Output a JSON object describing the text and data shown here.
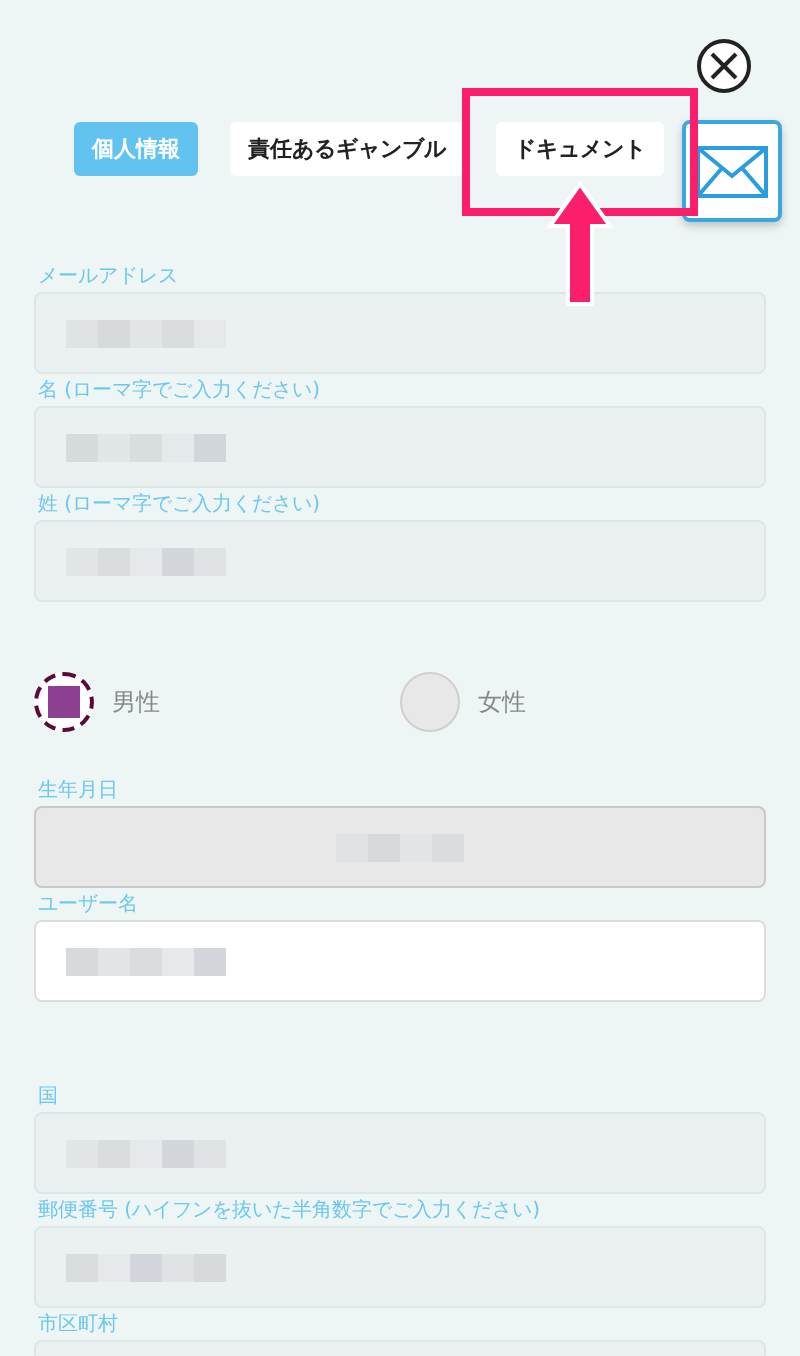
{
  "tabs": [
    {
      "label": "個人情報",
      "selected": true,
      "highlighted": false
    },
    {
      "label": "責任あるギャンブル",
      "selected": false,
      "highlighted": false
    },
    {
      "label": "ドキュメント",
      "selected": false,
      "highlighted": true
    }
  ],
  "fields_top": [
    {
      "label": "メールアドレス",
      "kind": "readonly",
      "blurred": true
    },
    {
      "label": "名 (ローマ字でご入力ください)",
      "kind": "readonly",
      "blurred": true
    },
    {
      "label": "姓 (ローマ字でご入力ください)",
      "kind": "readonly",
      "blurred": true
    }
  ],
  "gender": [
    {
      "label": "男性",
      "selected": true
    },
    {
      "label": "女性",
      "selected": false
    }
  ],
  "fields_bottom": [
    {
      "label": "生年月日",
      "kind": "date",
      "blurred": true
    },
    {
      "label": "ユーザー名",
      "kind": "editable",
      "blurred": true
    },
    {
      "label": "国",
      "kind": "readonly",
      "blurred": true,
      "gap_before": true
    },
    {
      "label": "郵便番号 (ハイフンを抜いた半角数字でご入力ください)",
      "kind": "readonly",
      "blurred": true
    },
    {
      "label": "市区町村",
      "kind": "readonly",
      "blurred": false
    }
  ]
}
